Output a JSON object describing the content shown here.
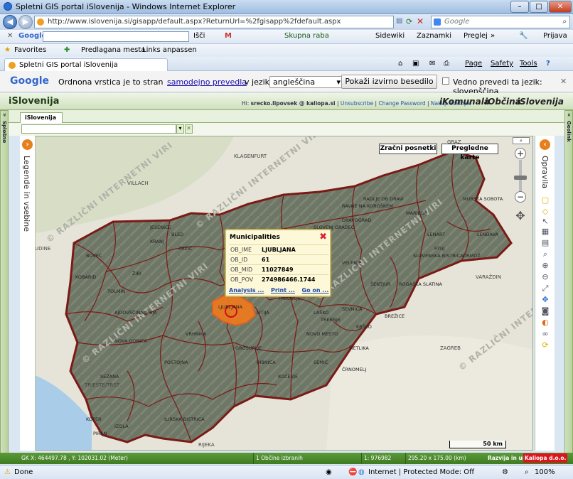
{
  "window": {
    "title": "Spletni GIS portal iSlovenija - Windows Internet Explorer"
  },
  "address": {
    "url": "http://www.islovenija.si/gisapp/default.aspx?ReturnUrl=%2fgisapp%2fdefault.aspx",
    "search_placeholder": "Google"
  },
  "google_toolbar": {
    "brand": "Google",
    "items": [
      "Išči",
      "M",
      "Skupna raba",
      "Sidewiki",
      "Zaznamki",
      "Preglej",
      "Prijava"
    ]
  },
  "favorites": {
    "label": "Favorites",
    "items": [
      "Predlagana mesta",
      "Links anpassen"
    ]
  },
  "tab": {
    "title": "Spletni GIS portal iSlovenija",
    "menu": [
      "Page",
      "Safety",
      "Tools"
    ]
  },
  "translate": {
    "brand": "Google",
    "prefix": "Ordnona vrstica je to stran",
    "link": "samodejno prevedla",
    "mid": "v jezik:",
    "language": "angleščina",
    "show_original": "Pokaži izvirno besedilo",
    "always_label": "Vedno prevedi ta jezik: slovenščina"
  },
  "app": {
    "title": "iSlovenija",
    "user_prefix": "Hi:",
    "user": "srecko.lipovsek @ kaliopa.si",
    "links": [
      "Unsubscribe",
      "Change Password",
      "Nakup dostopa"
    ],
    "brands": [
      "iKomunala",
      "iObčina",
      "iSlovenija"
    ],
    "left_side_label": "Splošno",
    "right_side_label": "Geolink",
    "map_tab": "iSlovenija"
  },
  "map": {
    "legend_label": "Legende in vsebine",
    "tools_label": "Opravila",
    "btn_aerial": "Zračni posnetki",
    "btn_overview": "Pregledne karte",
    "scale": "50 km",
    "watermark": "© RAZLIČNI INTERNETNI VIRI",
    "municipality_labels": [
      "LJUBLJANA",
      "KRANJ",
      "BOVEC",
      "KOBARID",
      "TOLMIN",
      "IDRIJA",
      "ŽIRI",
      "JESENICE",
      "BLED",
      "TRŽIČ",
      "KAMNIK",
      "CELJE",
      "VELENJE",
      "MARIBOR",
      "PTUJ",
      "MURSKA SOBOTA",
      "LENDAVA",
      "ORMOŽ",
      "SLOVENJ GRADEC",
      "DRAVOGRAD",
      "RAVNE NA KOROŠKEM",
      "ZAGORJE OB SAVI",
      "TRBOVLJE",
      "LAŠKO",
      "KRŠKO",
      "BREŽICE",
      "NOVO MESTO",
      "KOČEVJE",
      "RIBNICA",
      "GROSUPLJE",
      "VRHNIKA",
      "POSTOJNA",
      "ILIRSKA BISTRICA",
      "SEŽANA",
      "KOPER",
      "PIRAN",
      "IZOLA",
      "NOVA GORICA",
      "AJDOVŠČINA",
      "ČRNOMELJ",
      "METLIKA",
      "SEMIČ",
      "TREBNJE",
      "SEVNICA",
      "LITIJA",
      "ŠENTJUR",
      "ROGAŠKA SLATINA",
      "SLOVENSKA BISTRICA",
      "LENART",
      "RADLJE OB DRAVI"
    ],
    "city_labels": [
      "VILLACH",
      "KLAGENFURT",
      "GRAZ",
      "ZAGREB",
      "TRIESTE/TRST",
      "RIJEKA",
      "VARAŽDIN",
      "UDINE"
    ]
  },
  "popup": {
    "title": "Municipalities",
    "rows": [
      {
        "key": "OB_IME",
        "value": "LJUBLJANA"
      },
      {
        "key": "OB_ID",
        "value": "61"
      },
      {
        "key": "OB_MID",
        "value": "11027849"
      },
      {
        "key": "OB_POV",
        "value": "274986466.1744"
      }
    ],
    "links": [
      "Analysis ...",
      "Print ...",
      "Go on ..."
    ]
  },
  "status": {
    "coords": "GK X: 464497.78 , Y: 102031.02 (Meter)",
    "selected": "1 Občine izbranih",
    "scale": "1: 976982",
    "extent": "295.20 x 175.00 (km)",
    "dev": "Razvija in ureja",
    "company": "Kaliopa d.o.o."
  },
  "ie_status": {
    "left": "Done",
    "zone": "Internet | Protected Mode: Off",
    "zoom": "100%"
  },
  "colors": {
    "app_green": "#3f7c22",
    "region_outline": "#7a1a16",
    "selection": "#f07a1c",
    "popup_border": "#c9b45a"
  }
}
